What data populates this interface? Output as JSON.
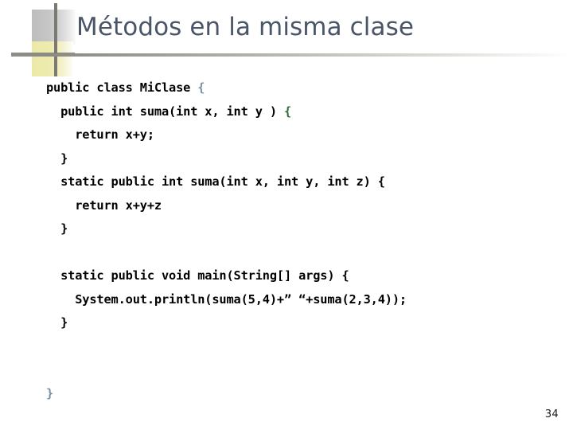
{
  "slide": {
    "title": "Métodos en la misma clase",
    "page_number": "34",
    "title_color": "#4a5568",
    "rule_color": "#8e8e86",
    "ornament": {
      "gray_square_color": "#bdbdbd",
      "yellow_square_color": "#ece9a8",
      "blue_block_color": "#4a7ea3",
      "line_color": "#7a7a72"
    }
  },
  "code": {
    "language": "java",
    "lines": [
      {
        "id": "line-1",
        "indent": 0,
        "text": "public class MiClase ",
        "trail_brace": "{",
        "brace_style": "outer"
      },
      {
        "id": "line-2",
        "indent": 2,
        "text": "public int suma(int x, int y ) ",
        "trail_brace": "{",
        "brace_style": "green"
      },
      {
        "id": "line-3",
        "indent": 4,
        "text": "return x+y;",
        "trail_brace": "",
        "brace_style": "none"
      },
      {
        "id": "line-4",
        "indent": 2,
        "text": "}",
        "trail_brace": "",
        "brace_style": "none"
      },
      {
        "id": "line-5",
        "indent": 2,
        "text": "static public int suma(int x, int y, int z) {",
        "trail_brace": "",
        "brace_style": "none"
      },
      {
        "id": "line-6",
        "indent": 4,
        "text": "return x+y+z",
        "trail_brace": "",
        "brace_style": "none"
      },
      {
        "id": "line-7",
        "indent": 2,
        "text": "}",
        "trail_brace": "",
        "brace_style": "none"
      },
      {
        "id": "line-8",
        "indent": 0,
        "text": "",
        "trail_brace": "",
        "brace_style": "none"
      },
      {
        "id": "line-9",
        "indent": 2,
        "text": "static public void main(String[] args) {",
        "trail_brace": "",
        "brace_style": "none"
      },
      {
        "id": "line-10",
        "indent": 4,
        "text": "System.out.println(suma(5,4)+” “+suma(2,3,4));",
        "trail_brace": "",
        "brace_style": "none"
      },
      {
        "id": "line-11",
        "indent": 2,
        "text": "}",
        "trail_brace": "",
        "brace_style": "none"
      },
      {
        "id": "line-12",
        "indent": 0,
        "text": "",
        "trail_brace": "",
        "brace_style": "none"
      },
      {
        "id": "line-13",
        "indent": 0,
        "text": "",
        "trail_brace": "",
        "brace_style": "none"
      },
      {
        "id": "line-14",
        "indent": 0,
        "text": "",
        "trail_brace": "}",
        "brace_style": "outer"
      }
    ]
  }
}
